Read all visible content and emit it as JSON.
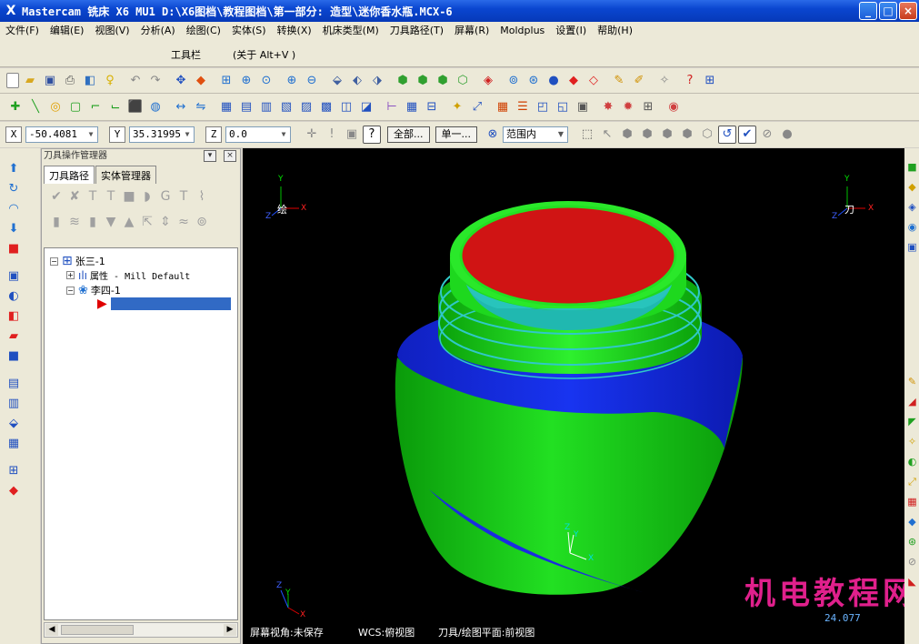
{
  "window": {
    "title": "Mastercam 铣床 X6 MU1  D:\\X6图档\\教程图档\\第一部分: 造型\\迷你香水瓶.MCX-6",
    "app_icon": "X",
    "minimize": "_",
    "maximize": "□",
    "close": "×"
  },
  "menu": [
    "文件(F)",
    "编辑(E)",
    "视图(V)",
    "分析(A)",
    "绘图(C)",
    "实体(S)",
    "转换(X)",
    "机床类型(M)",
    "刀具路径(T)",
    "屏幕(R)",
    "Moldplus",
    "设置(I)",
    "帮助(H)"
  ],
  "toolbar_caption": {
    "label": "工具栏",
    "shortcut": "(关于 Alt+V )"
  },
  "coords": {
    "x_label": "X",
    "x_value": "-50.4081",
    "y_label": "Y",
    "y_value": "35.31995",
    "z_label": "Z",
    "z_value": "0.0",
    "select_all": "全部...",
    "select_one": "单一...",
    "range_mode": "范围内"
  },
  "panel": {
    "title": "刀具操作管理器",
    "tab_toolpaths": "刀具路径",
    "tab_solids": "实体管理器",
    "tree": {
      "root": "张三-1",
      "properties": "属性 - Mill Default",
      "group": "李四-1"
    }
  },
  "viewport": {
    "status_view": "屏幕视角:未保存",
    "status_wcs": "WCS:俯视图",
    "status_plane": "刀具/绘图平面:前视图",
    "watermark": "机电教程网",
    "scale_value": "24.077",
    "axis_x": "X",
    "axis_y": "Y",
    "axis_z": "Z",
    "gview_label_left": "绘",
    "gview_label_right": "刀"
  },
  "colors": {
    "titlebar": "#0a46d0",
    "body_green": "#14c814",
    "rim_green": "#22e022",
    "thread_cyan": "#30c8c8",
    "inner_red": "#e01818",
    "inner_floor": "#20b8b0",
    "shoulder_blue": "#1428e0",
    "watermark": "#e0208c"
  }
}
